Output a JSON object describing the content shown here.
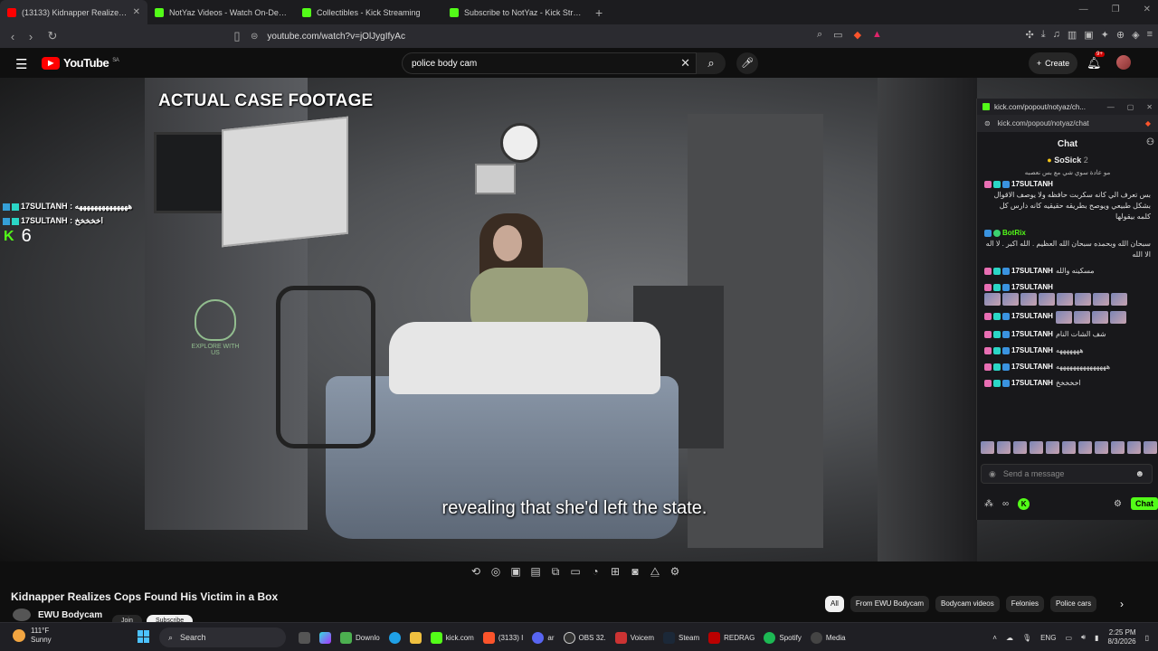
{
  "browser": {
    "tabs": [
      {
        "label": "(13133) Kidnapper Realizes C",
        "icon": "youtube-icon",
        "active": true
      },
      {
        "label": "NotYaz Videos - Watch On-Demand",
        "icon": "kick-icon",
        "active": false
      },
      {
        "label": "Collectibles - Kick Streaming",
        "icon": "kick-icon",
        "active": false
      },
      {
        "label": "Subscribe to NotYaz - Kick Streaming",
        "icon": "kick-icon",
        "active": false
      }
    ],
    "url": "youtube.com/watch?v=jOlJygIfyAc"
  },
  "youtube": {
    "logo": "YouTube",
    "region": "SA",
    "search_query": "police body cam",
    "create_label": "Create",
    "notif_badge": "9+"
  },
  "video": {
    "tagline": "ACTUAL CASE FOOTAGE",
    "caption": "revealing that she'd left the state.",
    "watermark": "EXPLORE WITH US",
    "overlay_chat": [
      {
        "user": "17SULTANH",
        "text": "ههههههههههههههه"
      },
      {
        "user": "17SULTANH",
        "text": "اخخخخخ"
      }
    ],
    "viewer_count": "6"
  },
  "below": {
    "title": "Kidnapper Realizes Cops Found His Victim in a Box",
    "channel": "EWU Bodycam",
    "join": "Join",
    "subscribe": "Subscribe",
    "chips": [
      "All",
      "From EWU Bodycam",
      "Bodycam videos",
      "Felonies",
      "Police cars"
    ]
  },
  "kick_popout": {
    "window_title": "kick.com/popout/notyaz/ch...",
    "url": "kick.com/popout/notyaz/chat",
    "chat_title": "Chat",
    "pinned_user": "SoSick",
    "pinned_count": "2",
    "pinned_text": "مو عادة سوي شي مع بس نعصبه",
    "messages": [
      {
        "user": "17SULTANH",
        "text": "بس تعرف الي كانه سكربت حافظه ولا يوصف الاقوال بشكل طبيعي ويوصح بطريقه حقيقيه كانه دارس كل كلمه بيقولها",
        "emotes": 0,
        "bot": false
      },
      {
        "user": "BotRix",
        "text": "سبحان الله وبحمده سبحان الله العظيم . الله اكبر . لا اله الا الله",
        "emotes": 0,
        "bot": true
      },
      {
        "user": "17SULTANH",
        "text": "مسكينه والله",
        "emotes": 0,
        "bot": false
      },
      {
        "user": "17SULTANH",
        "text": "",
        "emotes": 8,
        "bot": false
      },
      {
        "user": "17SULTANH",
        "text": "",
        "emotes": 4,
        "bot": false
      },
      {
        "user": "17SULTANH",
        "text": "شف الشات النام",
        "emotes": 0,
        "bot": false
      },
      {
        "user": "17SULTANH",
        "text": "هههههههه",
        "emotes": 0,
        "bot": false
      },
      {
        "user": "17SULTANH",
        "text": "هههههههههههههههه",
        "emotes": 0,
        "bot": false
      },
      {
        "user": "17SULTANH",
        "text": "اخخخخخ",
        "emotes": 0,
        "bot": false
      }
    ],
    "send_placeholder": "Send a message",
    "chat_button": "Chat"
  },
  "taskbar": {
    "temp": "111°F",
    "weather": "Sunny",
    "search": "Search",
    "apps": [
      "Downlo",
      "kick.com",
      "(3133) I",
      "ar",
      "OBS 32.",
      "Voicem",
      "Steam",
      "REDRAG",
      "Spotify",
      "Media"
    ],
    "lang": "ENG",
    "time": "2:25 PM",
    "date": "8/3/2026"
  }
}
